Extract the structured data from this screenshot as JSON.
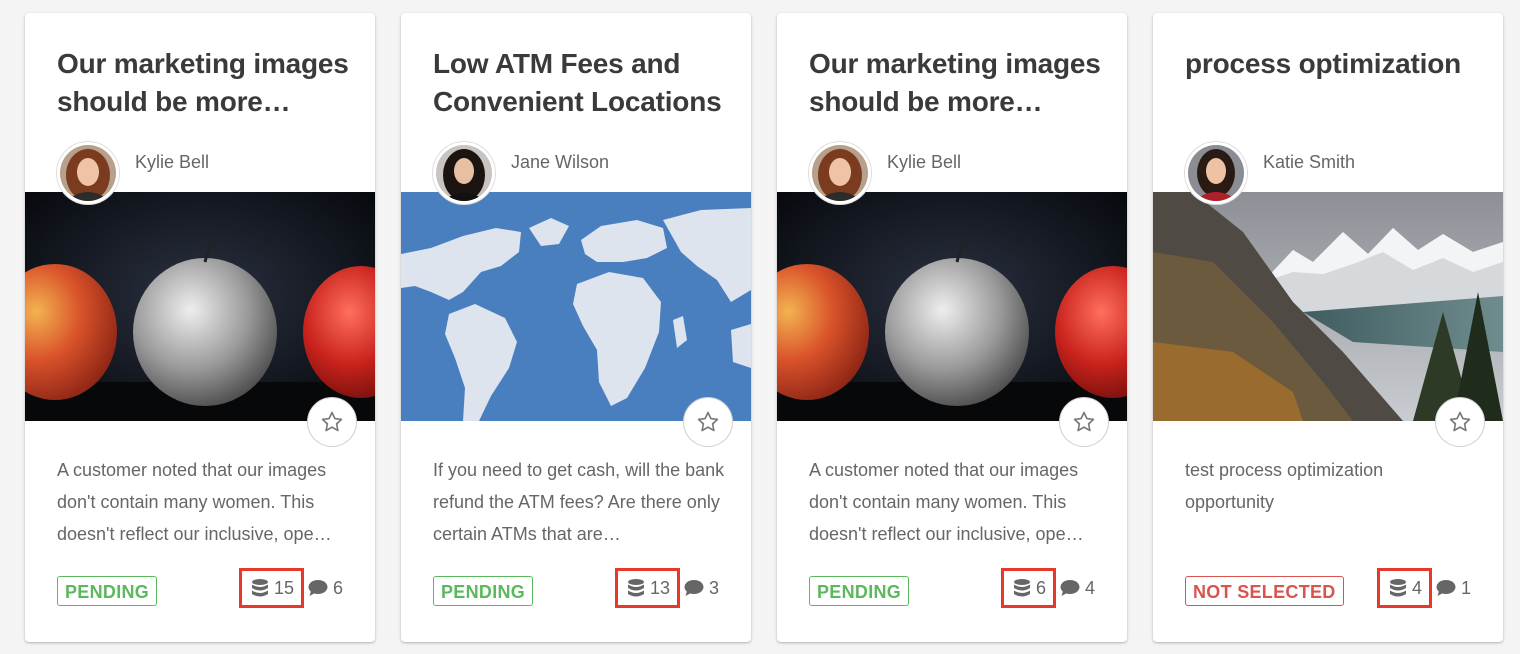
{
  "cards": [
    {
      "title": "Our marketing images should be more…",
      "author": "Kylie Bell",
      "description": "A customer noted that our images don't contain many women. This doesn't reflect our inclusive, ope…",
      "status": "PENDING",
      "data_count": "15",
      "comment_count": "6",
      "hero": "apples"
    },
    {
      "title": "Low ATM Fees and Convenient Locations",
      "author": "Jane Wilson",
      "description": "If you need to get cash, will the bank refund the ATM fees? Are there only certain ATMs that are…",
      "status": "PENDING",
      "data_count": "13",
      "comment_count": "3",
      "hero": "world-map"
    },
    {
      "title": "Our marketing images should be more…",
      "author": "Kylie Bell",
      "description": "A customer noted that our images don't contain many women. This doesn't reflect our inclusive, ope…",
      "status": "PENDING",
      "data_count": "6",
      "comment_count": "4",
      "hero": "apples"
    },
    {
      "title": "process optimization",
      "author": "Katie Smith",
      "description": "test process optimization opportunity",
      "status": "NOT SELECTED",
      "data_count": "4",
      "comment_count": "1",
      "hero": "mountains"
    }
  ],
  "icons": {
    "star": "star-outline-icon",
    "data": "database-icon",
    "comment": "speech-bubble-icon"
  },
  "colors": {
    "pending": "#5cb85c",
    "not_selected": "#d9534f",
    "highlight": "#e53a2b",
    "map_ocean": "#4a7fbf"
  }
}
